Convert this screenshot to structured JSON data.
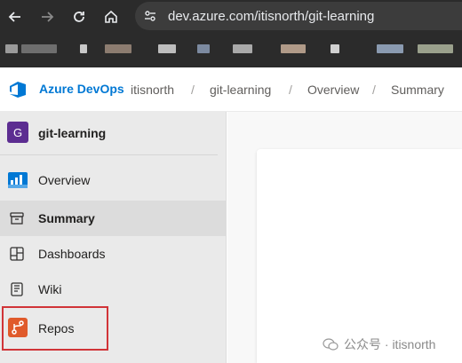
{
  "browser": {
    "url": "dev.azure.com/itisnorth/git-learning"
  },
  "topnav": {
    "brand": "Azure DevOps",
    "breadcrumbs": [
      "itisnorth",
      "git-learning",
      "Overview",
      "Summary"
    ],
    "separator": "/"
  },
  "sidebar": {
    "project_initial": "G",
    "project_name": "git-learning",
    "items": [
      {
        "label": "Overview",
        "icon": "overview-icon"
      },
      {
        "label": "Summary",
        "icon": "summary-icon",
        "selected": true
      },
      {
        "label": "Dashboards",
        "icon": "dashboards-icon"
      },
      {
        "label": "Wiki",
        "icon": "wiki-icon"
      },
      {
        "label": "Repos",
        "icon": "repos-icon",
        "highlighted": true
      }
    ]
  },
  "watermark": {
    "text": "公众号 · itisnorth"
  },
  "colors": {
    "accent": "#0078d4",
    "project_avatar": "#5c2d91",
    "highlight_border": "#d13438",
    "repos_icon": "#e05a2b"
  }
}
